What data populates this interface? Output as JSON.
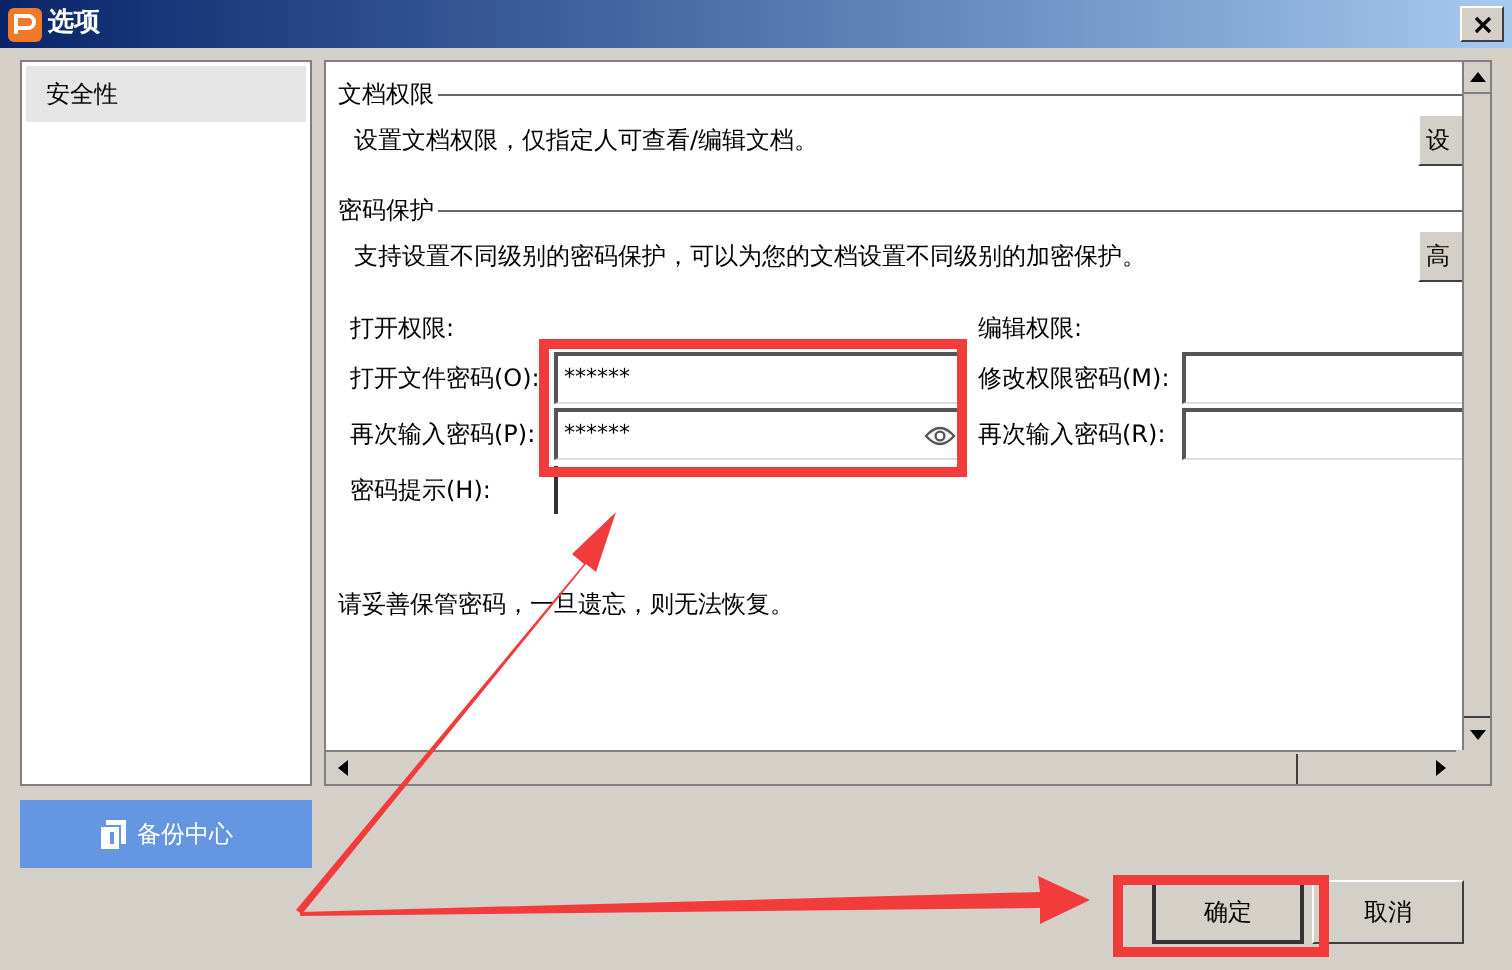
{
  "window": {
    "title": "选项"
  },
  "sidebar": {
    "items": [
      {
        "label": "安全性",
        "selected": true
      }
    ]
  },
  "backup_button": {
    "label": "备份中心"
  },
  "sections": [
    {
      "title": "文档权限",
      "description": "设置文档权限，仅指定人可查看/编辑文档。",
      "button": "设"
    },
    {
      "title": "密码保护",
      "description": "支持设置不同级别的密码保护，可以为您的文档设置不同级别的加密保护。",
      "button": "高"
    }
  ],
  "open_permission": {
    "heading": "打开权限:",
    "fields": [
      {
        "label": "打开文件密码(O):",
        "value": "******",
        "reveal_icon": false
      },
      {
        "label": "再次输入密码(P):",
        "value": "******",
        "reveal_icon": true
      }
    ]
  },
  "edit_permission": {
    "heading": "编辑权限:",
    "fields": [
      {
        "label": "修改权限密码(M):"
      },
      {
        "label": "再次输入密码(R):"
      }
    ]
  },
  "hint": {
    "label": "密码提示(H):"
  },
  "note": "请妥善保管密码，一旦遗忘，则无法恢复。",
  "buttons": [
    {
      "label": "确定",
      "selected": true
    },
    {
      "label": "取消",
      "selected": false
    }
  ]
}
